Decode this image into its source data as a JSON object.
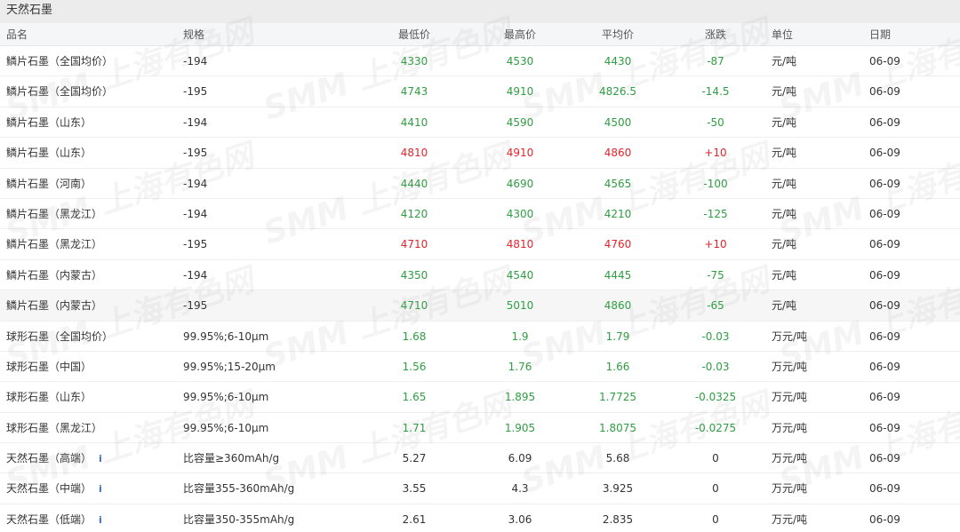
{
  "section_title": "天然石墨",
  "headers": {
    "name": "品名",
    "spec": "规格",
    "low": "最低价",
    "high": "最高价",
    "avg": "平均价",
    "change": "涨跌",
    "unit": "单位",
    "date": "日期"
  },
  "colors": {
    "up": "#e0252c",
    "down": "#2f9d42",
    "flat": "#333333",
    "info_icon": "#3f6fb5"
  },
  "watermark": "SMM 上海有色网",
  "rows": [
    {
      "name": "鳞片石墨（全国均价）",
      "spec": "-194",
      "low": "4330",
      "high": "4530",
      "avg": "4430",
      "change": "-87",
      "unit": "元/吨",
      "date": "06-09",
      "trend": "down"
    },
    {
      "name": "鳞片石墨（全国均价）",
      "spec": "-195",
      "low": "4743",
      "high": "4910",
      "avg": "4826.5",
      "change": "-14.5",
      "unit": "元/吨",
      "date": "06-09",
      "trend": "down"
    },
    {
      "name": "鳞片石墨（山东）",
      "spec": "-194",
      "low": "4410",
      "high": "4590",
      "avg": "4500",
      "change": "-50",
      "unit": "元/吨",
      "date": "06-09",
      "trend": "down"
    },
    {
      "name": "鳞片石墨（山东）",
      "spec": "-195",
      "low": "4810",
      "high": "4910",
      "avg": "4860",
      "change": "+10",
      "unit": "元/吨",
      "date": "06-09",
      "trend": "up"
    },
    {
      "name": "鳞片石墨（河南）",
      "spec": "-194",
      "low": "4440",
      "high": "4690",
      "avg": "4565",
      "change": "-100",
      "unit": "元/吨",
      "date": "06-09",
      "trend": "down"
    },
    {
      "name": "鳞片石墨（黑龙江）",
      "spec": "-194",
      "low": "4120",
      "high": "4300",
      "avg": "4210",
      "change": "-125",
      "unit": "元/吨",
      "date": "06-09",
      "trend": "down"
    },
    {
      "name": "鳞片石墨（黑龙江）",
      "spec": "-195",
      "low": "4710",
      "high": "4810",
      "avg": "4760",
      "change": "+10",
      "unit": "元/吨",
      "date": "06-09",
      "trend": "up"
    },
    {
      "name": "鳞片石墨（内蒙古）",
      "spec": "-194",
      "low": "4350",
      "high": "4540",
      "avg": "4445",
      "change": "-75",
      "unit": "元/吨",
      "date": "06-09",
      "trend": "down"
    },
    {
      "name": "鳞片石墨（内蒙古）",
      "spec": "-195",
      "low": "4710",
      "high": "5010",
      "avg": "4860",
      "change": "-65",
      "unit": "元/吨",
      "date": "06-09",
      "trend": "down",
      "highlight": true
    },
    {
      "name": "球形石墨（全国均价）",
      "spec": "99.95%;6-10μm",
      "low": "1.68",
      "high": "1.9",
      "avg": "1.79",
      "change": "-0.03",
      "unit": "万元/吨",
      "date": "06-09",
      "trend": "down"
    },
    {
      "name": "球形石墨（中国）",
      "spec": "99.95%;15-20μm",
      "low": "1.56",
      "high": "1.76",
      "avg": "1.66",
      "change": "-0.03",
      "unit": "万元/吨",
      "date": "06-09",
      "trend": "down"
    },
    {
      "name": "球形石墨（山东）",
      "spec": "99.95%;6-10μm",
      "low": "1.65",
      "high": "1.895",
      "avg": "1.7725",
      "change": "-0.0325",
      "unit": "万元/吨",
      "date": "06-09",
      "trend": "down"
    },
    {
      "name": "球形石墨（黑龙江）",
      "spec": "99.95%;6-10μm",
      "low": "1.71",
      "high": "1.905",
      "avg": "1.8075",
      "change": "-0.0275",
      "unit": "万元/吨",
      "date": "06-09",
      "trend": "down"
    },
    {
      "name": "天然石墨（高端）",
      "spec": "比容量≥360mAh/g",
      "low": "5.27",
      "high": "6.09",
      "avg": "5.68",
      "change": "0",
      "unit": "万元/吨",
      "date": "06-09",
      "trend": "flat",
      "info": "i"
    },
    {
      "name": "天然石墨（中端）",
      "spec": "比容量355-360mAh/g",
      "low": "3.55",
      "high": "4.3",
      "avg": "3.925",
      "change": "0",
      "unit": "万元/吨",
      "date": "06-09",
      "trend": "flat",
      "info": "i"
    },
    {
      "name": "天然石墨（低端）",
      "spec": "比容量350-355mAh/g",
      "low": "2.61",
      "high": "3.06",
      "avg": "2.835",
      "change": "0",
      "unit": "万元/吨",
      "date": "06-09",
      "trend": "flat",
      "info": "i"
    }
  ]
}
